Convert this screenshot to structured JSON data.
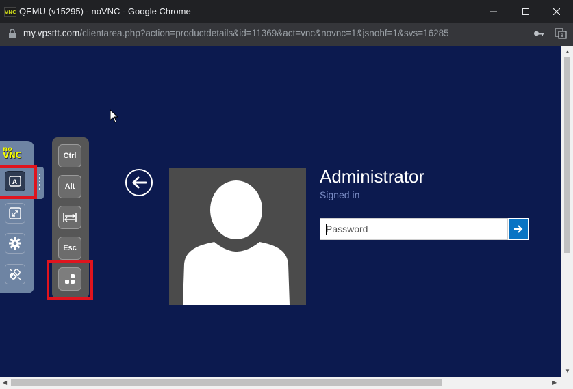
{
  "window": {
    "favicon_text": "VNC",
    "title": "QEMU (v15295) - noVNC - Google Chrome"
  },
  "address_bar": {
    "host": "my.vpsttt.com",
    "path": "/clientarea.php?action=productdetails&id=11369&act=vnc&novnc=1&jsnohf=1&svs=16285"
  },
  "novnc": {
    "logo_no": "no",
    "logo_vnc": "VNC",
    "buttons": [
      {
        "name": "extra-keys",
        "icon": "keyboard-A-icon",
        "active": true
      },
      {
        "name": "fullscreen",
        "icon": "fullscreen-icon"
      },
      {
        "name": "settings",
        "icon": "gear-icon"
      },
      {
        "name": "disconnect",
        "icon": "disconnect-icon"
      }
    ],
    "keys": {
      "ctrl": "Ctrl",
      "alt": "Alt",
      "tab": "tab-icon",
      "esc": "Esc",
      "ctrl_alt_del": "ctrl-alt-del-icon"
    }
  },
  "login": {
    "username": "Administrator",
    "status": "Signed in",
    "password_placeholder": "Password"
  },
  "colors": {
    "desktop_bg": "#0c1a4f",
    "submit_bg": "#0a74c4",
    "highlight": "#e0141e"
  }
}
